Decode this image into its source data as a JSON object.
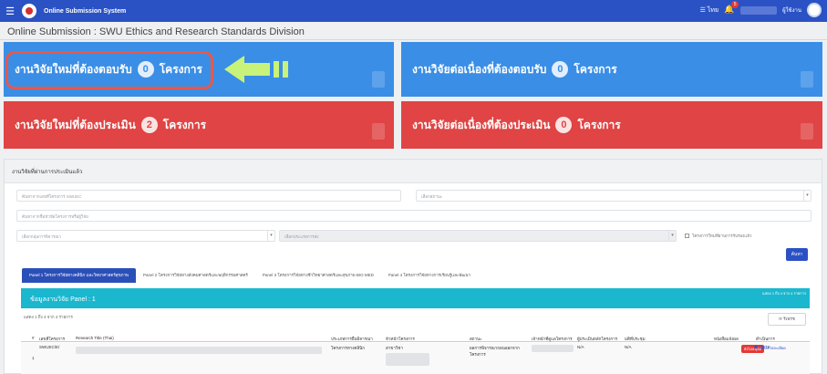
{
  "topbar": {
    "title": "Online Submission System",
    "lang": "☰ ไทย",
    "bell_count": "5",
    "user_label": "ผู้ใช้งาน"
  },
  "page_heading": "Online Submission : SWU Ethics and Research Standards Division",
  "cards": {
    "new_to_respond": {
      "prefix": "งานวิจัยใหม่ที่ต้องตอบรับ",
      "count": "0",
      "suffix": "โครงการ"
    },
    "cont_to_respond": {
      "prefix": "งานวิจัยต่อเนื่องที่ต้องตอบรับ",
      "count": "0",
      "suffix": "โครงการ"
    },
    "new_to_evaluate": {
      "prefix": "งานวิจัยใหม่ที่ต้องประเมิน",
      "count": "2",
      "suffix": "โครงการ"
    },
    "cont_to_evaluate": {
      "prefix": "งานวิจัยต่อเนื่องที่ต้องประเมิน",
      "count": "0",
      "suffix": "โครงการ"
    }
  },
  "panel": {
    "title": "งานวิจัยที่ผ่านการประเมินแล้ว",
    "search_code": "ค้นหาจากเลขที่โครงการ SWUEC",
    "search_status": "เลือกสถานะ",
    "search_title": "ค้นหาจากชื่อหัวข้อโครงการหรือผู้วิจัย",
    "select_group": "เลือกกลุ่มการพิจารณา",
    "select_type": "เลือกประเภทการส่ง",
    "checkbox_label": "โครงการใหม่ที่ผ่านการรับรองแล้ว",
    "search_button": "ค้นหา",
    "tabs": [
      "Panel 1 โครงการวิจัยทางคลินิก และวิทยาศาสตร์สุขภาพ",
      "Panel 2 โครงการวิจัยทางสังคมศาสตร์และพฤติกรรมศาสตร์",
      "Panel 3 โครงการวิจัยทางชีววิทยาศาสตร์และสุขภาพ BIO MED",
      "Panel 4 โครงการวิจัยทางการเรียนรู้และพัฒนา"
    ],
    "data_bar_title": "ข้อมูลงานวิจัย Panel : 1",
    "data_bar_right": "แสดง 1 ถึง 4 จาก 4 รายการ",
    "count_text": "แสดง 1 ถึง 4 จาก 4 รายการ",
    "refresh_button": "⟳ รีเฟรช",
    "columns": [
      "#",
      "เลขที่โครงการ",
      "Research Title (Thai)",
      "ประเภทการยื่นพิจารณา",
      "หัวหน้าโครงการ",
      "สถานะ",
      "เจ้าหน้าที่ดูแลโครงการ",
      "ผู้ประเมินหลักโครงการ",
      "มติที่ประชุม",
      "หนังสือแจ้งผล",
      "ดำเนินการ"
    ],
    "row": {
      "index": "1",
      "code": "SWUEC/E/",
      "type": "โครงการทางคลินิก",
      "pi": "สาขาวิชา",
      "status": "ผลการพิจารณาถอนออกจากโครงการ",
      "reviewer": "N/A",
      "resolution": "N/A",
      "badge": "ยังไม่อนุมัติ",
      "note": "❶ NOTE",
      "action": "ⓘ แสดงรายละเอียด"
    }
  },
  "colors": {
    "topbar": "#2b52c4",
    "card_blue": "#3a8ee6",
    "card_red": "#e04444",
    "cyan": "#1ab7cf",
    "highlight": "#e8584a",
    "arrow": "#c8f27a"
  }
}
